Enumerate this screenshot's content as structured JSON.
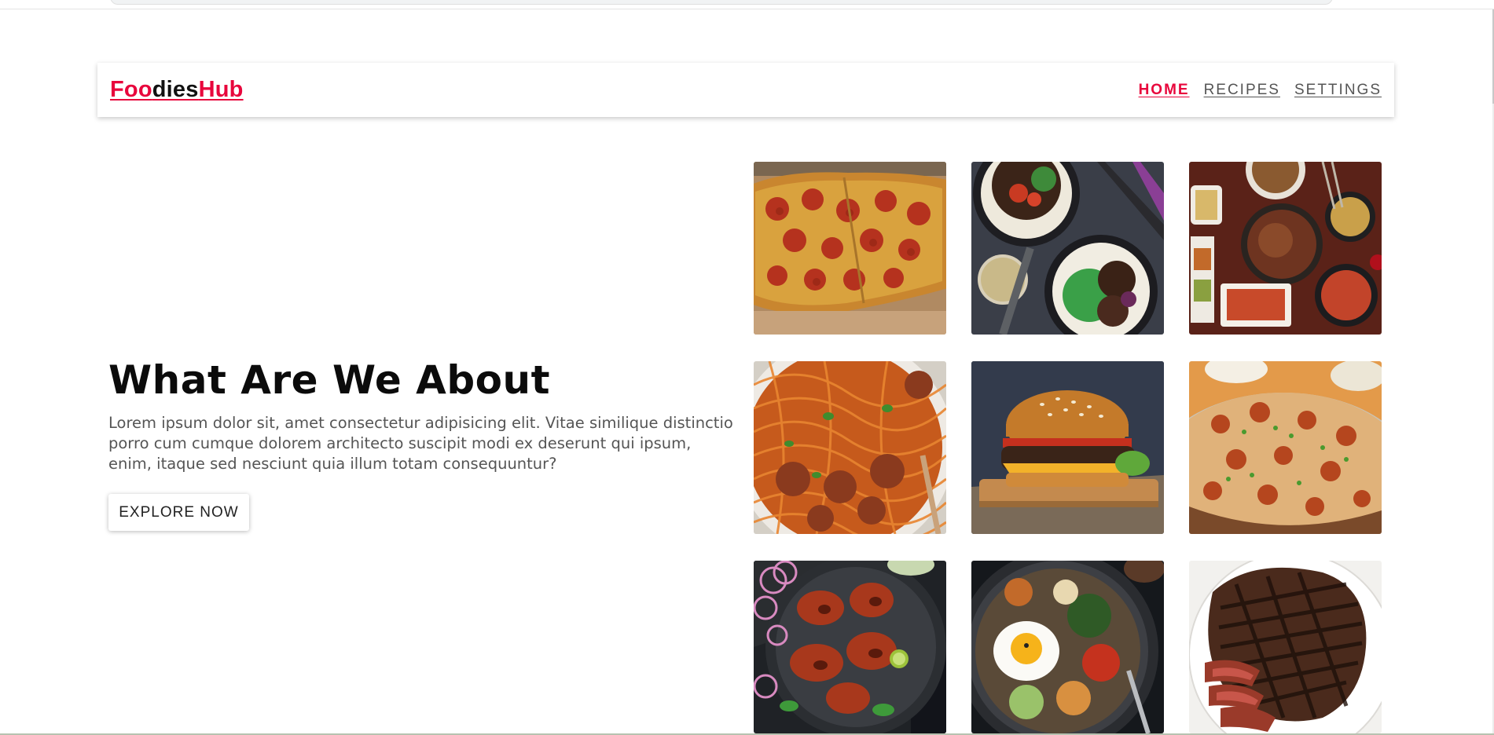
{
  "navbar": {
    "logo_part1": "Foo",
    "logo_part2": "dies",
    "logo_part3": "Hub",
    "links": [
      {
        "label": "HOME",
        "active": true
      },
      {
        "label": "RECIPES",
        "active": false
      },
      {
        "label": "SETTINGS",
        "active": false
      }
    ]
  },
  "hero": {
    "title": "What Are We About",
    "description": "Lorem ipsum dolor sit, amet consectetur adipisicing elit. Vitae similique distinctio porro cum cumque dolorem architecto suscipit modi ex deserunt qui ipsum, enim, itaque sed nesciunt quia illum totam consequuntur?",
    "button_label": "EXPLORE NOW"
  },
  "food_images": [
    {
      "dish": "pizza"
    },
    {
      "dish": "beef-rice-bowls"
    },
    {
      "dish": "korean-spread"
    },
    {
      "dish": "spaghetti-meatballs"
    },
    {
      "dish": "burger"
    },
    {
      "dish": "biryani"
    },
    {
      "dish": "tandoori-chicken"
    },
    {
      "dish": "bibimbap"
    },
    {
      "dish": "steak"
    }
  ],
  "colors": {
    "accent": "#e8063c",
    "text_dark": "#0b0b0b",
    "text_muted": "#555555"
  }
}
